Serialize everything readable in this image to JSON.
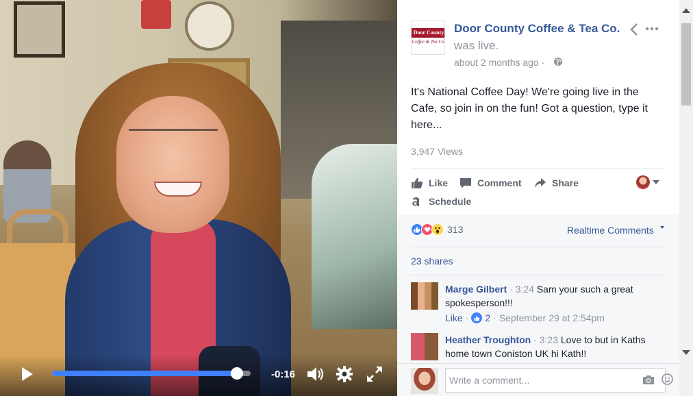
{
  "video": {
    "time_remaining": "-0:16",
    "progress_fraction": 0.93,
    "accent_color": "#4080ff"
  },
  "post": {
    "page_name": "Door County Coffee & Tea Co.",
    "logo_text_top": "Door County",
    "logo_text_script": "Coffee & Tea Co.",
    "status": "was live.",
    "timestamp": "about 2 months ago",
    "separator": "·",
    "text": "It's National Coffee Day! We're going live in the Cafe, so join in on the fun! Got a question, type it here...",
    "views": "3,947 Views"
  },
  "actions": {
    "like": "Like",
    "comment": "Comment",
    "share": "Share",
    "schedule": "Schedule"
  },
  "reactions": {
    "count": "313",
    "icons": [
      "like-icon",
      "love-icon",
      "wow-icon"
    ]
  },
  "realtime_label": "Realtime Comments",
  "shares": "23 shares",
  "comments": [
    {
      "name": "Marge Gilbert",
      "time": "3:24",
      "text": "Sam your such a great spokesperson!!!",
      "like_label": "Like",
      "like_count": "2",
      "date": "September 29 at 2:54pm"
    },
    {
      "name": "Heather Troughton",
      "time": "3:23",
      "text": "Love to but in Kaths home town Coniston UK hi Kath!!"
    }
  ],
  "composer": {
    "placeholder": "Write a comment..."
  }
}
